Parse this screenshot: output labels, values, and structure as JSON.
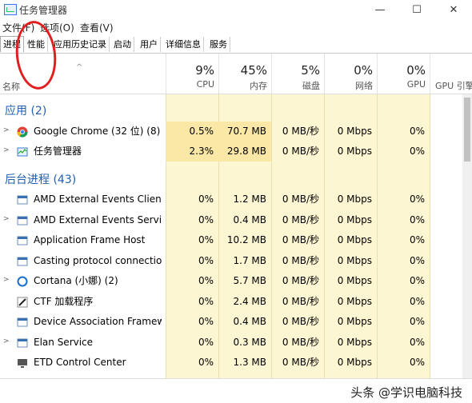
{
  "window": {
    "title": "任务管理器",
    "minimize": "—",
    "maximize": "☐",
    "close": "✕"
  },
  "menu": [
    "文件(F)",
    "选项(O)",
    "查看(V)"
  ],
  "tabs": [
    "进程",
    "性能",
    "应用历史记录",
    "启动",
    "用户",
    "详细信息",
    "服务"
  ],
  "header": {
    "name_label": "名称",
    "columns": [
      {
        "pct": "9%",
        "name": "CPU"
      },
      {
        "pct": "45%",
        "name": "内存"
      },
      {
        "pct": "5%",
        "name": "磁盘"
      },
      {
        "pct": "0%",
        "name": "网络"
      },
      {
        "pct": "0%",
        "name": "GPU"
      },
      {
        "pct": "",
        "name": "GPU 引擎"
      }
    ]
  },
  "groups": {
    "apps": "应用 (2)",
    "background": "后台进程 (43)"
  },
  "apps": [
    {
      "name": "Google Chrome (32 位) (8)",
      "icon": "chrome-icon",
      "cpu": "0.5%",
      "mem": "70.7 MB",
      "disk": "0 MB/秒",
      "net": "0 Mbps",
      "gpu": "0%"
    },
    {
      "name": "任务管理器",
      "icon": "task-manager-icon",
      "cpu": "2.3%",
      "mem": "29.8 MB",
      "disk": "0 MB/秒",
      "net": "0 Mbps",
      "gpu": "0%"
    }
  ],
  "background": [
    {
      "name": "AMD External Events Client ...",
      "icon": "app-window-icon",
      "expand": false,
      "cpu": "0%",
      "mem": "1.2 MB",
      "disk": "0 MB/秒",
      "net": "0 Mbps",
      "gpu": "0%"
    },
    {
      "name": "AMD External Events Service...",
      "icon": "app-window-icon",
      "expand": true,
      "cpu": "0%",
      "mem": "0.4 MB",
      "disk": "0 MB/秒",
      "net": "0 Mbps",
      "gpu": "0%"
    },
    {
      "name": "Application Frame Host",
      "icon": "app-window-icon",
      "expand": false,
      "cpu": "0%",
      "mem": "10.2 MB",
      "disk": "0 MB/秒",
      "net": "0 Mbps",
      "gpu": "0%"
    },
    {
      "name": "Casting protocol connection ...",
      "icon": "app-window-icon",
      "expand": false,
      "cpu": "0%",
      "mem": "1.7 MB",
      "disk": "0 MB/秒",
      "net": "0 Mbps",
      "gpu": "0%"
    },
    {
      "name": "Cortana (小娜) (2)",
      "icon": "cortana-icon",
      "expand": true,
      "cpu": "0%",
      "mem": "5.7 MB",
      "disk": "0 MB/秒",
      "net": "0 Mbps",
      "gpu": "0%"
    },
    {
      "name": "CTF 加载程序",
      "icon": "pen-icon",
      "expand": false,
      "cpu": "0%",
      "mem": "2.4 MB",
      "disk": "0 MB/秒",
      "net": "0 Mbps",
      "gpu": "0%"
    },
    {
      "name": "Device Association Framewo...",
      "icon": "app-window-icon",
      "expand": false,
      "cpu": "0%",
      "mem": "0.4 MB",
      "disk": "0 MB/秒",
      "net": "0 Mbps",
      "gpu": "0%"
    },
    {
      "name": "Elan Service",
      "icon": "app-window-icon",
      "expand": true,
      "cpu": "0%",
      "mem": "0.3 MB",
      "disk": "0 MB/秒",
      "net": "0 Mbps",
      "gpu": "0%"
    },
    {
      "name": "ETD Control Center",
      "icon": "monitor-icon",
      "expand": false,
      "cpu": "0%",
      "mem": "1.3 MB",
      "disk": "0 MB/秒",
      "net": "0 Mbps",
      "gpu": "0%"
    }
  ],
  "watermark": "头条 @学识电脑科技"
}
